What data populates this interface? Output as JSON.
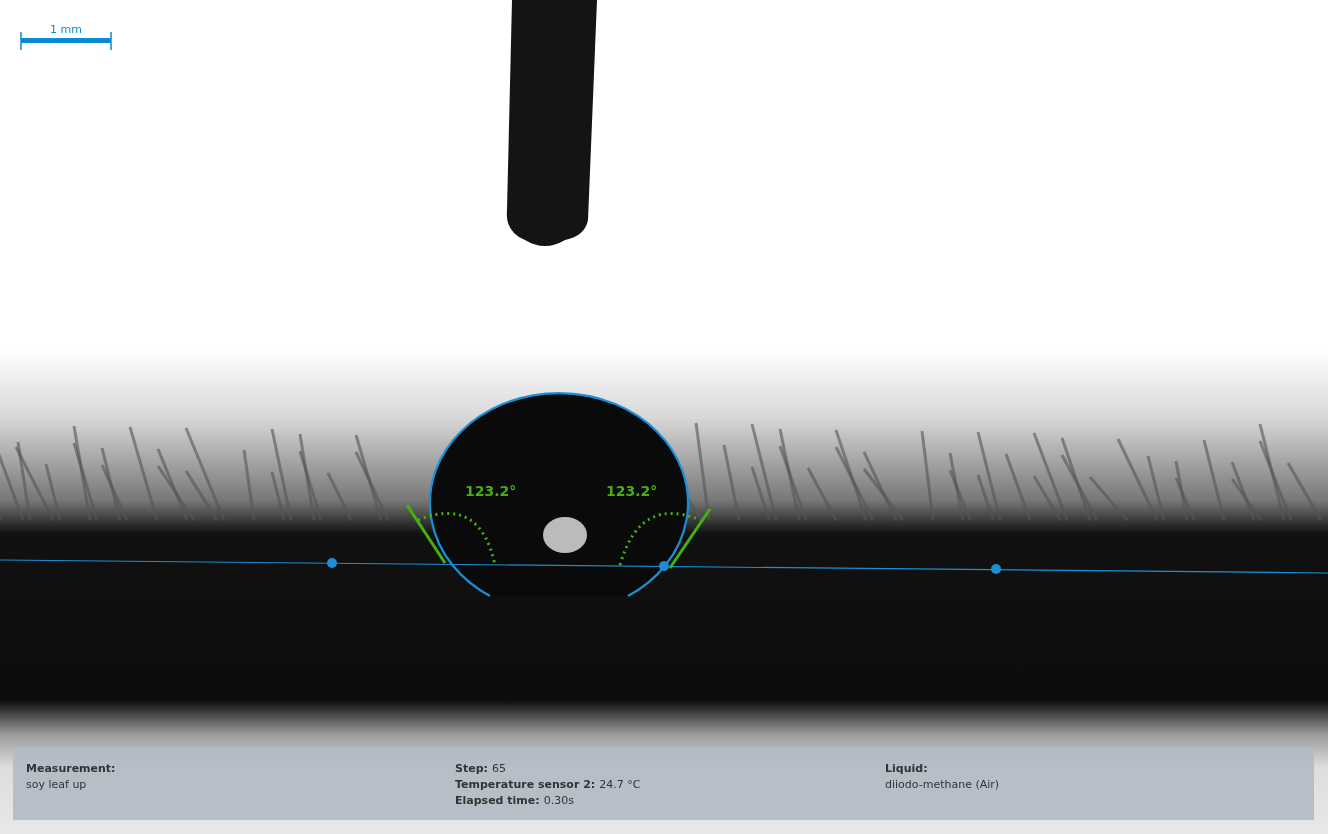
{
  "scale_bar": {
    "label": "1 mm"
  },
  "contact_angles": [
    {
      "label": "123.2°"
    },
    {
      "label": "123.2°"
    }
  ],
  "info_panel": {
    "columns": [
      {
        "items": [
          {
            "kind": "stacked",
            "label": "Measurement:",
            "value": "soy leaf up"
          }
        ]
      },
      {
        "items": [
          {
            "kind": "inline",
            "label": "Step:",
            "value": "65"
          },
          {
            "kind": "inline",
            "label": "Temperature sensor 2:",
            "value": "24.7 °C"
          },
          {
            "kind": "inline",
            "label": "Elapsed time:",
            "value": "0.30s"
          }
        ]
      },
      {
        "items": [
          {
            "kind": "stacked",
            "label": "Liquid:",
            "value": "diiodo-methane (Air)"
          }
        ]
      }
    ]
  }
}
